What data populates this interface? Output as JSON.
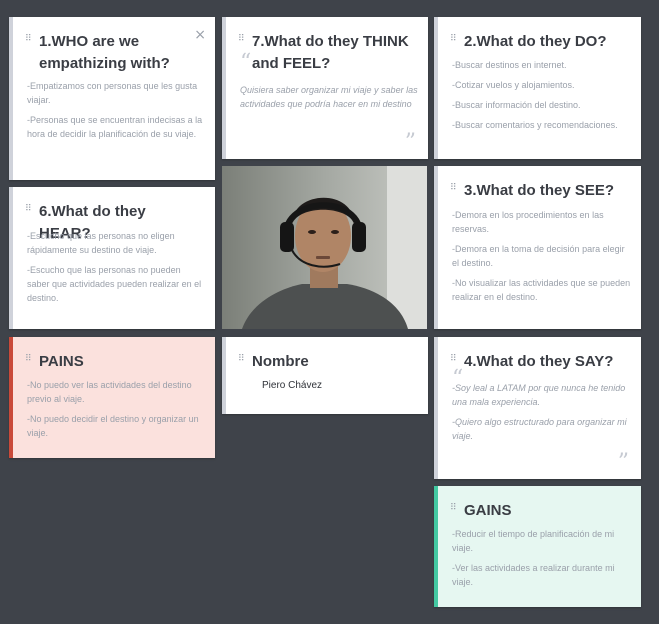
{
  "cards": {
    "who": {
      "title": "1.WHO are we empathizing with?",
      "close": "×",
      "items": [
        "-Empatizamos con personas que les gusta viajar.",
        "-Personas que se encuentran indecisas a la hora de decidir la planificación de su viaje."
      ]
    },
    "think": {
      "title": "7.What do they THINK and FEEL?",
      "items": [
        "Quisiera saber organizar mi viaje y saber las actividades que podría hacer en mi destino"
      ]
    },
    "do": {
      "title": "2.What do they DO?",
      "items": [
        "-Buscar destinos en internet.",
        "-Cotizar vuelos y alojamientos.",
        "-Buscar información del destino.",
        "-Buscar comentarios y recomendaciones."
      ]
    },
    "hear": {
      "title": "6.What do they HEAR?",
      "items": [
        "-Escucho que las personas no eligen rápidamente su destino de viaje.",
        "-Escucho que las personas no pueden saber que actividades pueden realizar en el destino."
      ]
    },
    "see": {
      "title": "3.What do they SEE?",
      "items": [
        "-Demora en los procedimientos en las reservas.",
        "-Demora en la toma de decisión para elegir el destino.",
        "-No visualizar las actividades que se pueden realizar en el destino."
      ]
    },
    "pains": {
      "title": "PAINS",
      "items": [
        "-No puedo ver las actividades del destino previo al viaje.",
        "-No puedo decidir el destino y organizar un viaje."
      ]
    },
    "name": {
      "title": "Nombre",
      "value": "Piero Chávez"
    },
    "say": {
      "title": "4.What do they SAY?",
      "items": [
        "-Soy leal a LATAM por que nunca he tenido una mala experiencia.",
        "-Quiero algo estructurado para organizar mi viaje."
      ]
    },
    "gains": {
      "title": "GAINS",
      "items": [
        "-Reducir el tiempo de planificación de mi viaje.",
        "-Ver las actividades a realizar durante mi viaje."
      ]
    }
  },
  "icons": {
    "grip": "drag-handle-icon",
    "quote_open": "“",
    "quote_close": "”"
  },
  "colors": {
    "board": "#3f434a",
    "pains_bg": "#fbe1dd",
    "pains_accent": "#c94a3a",
    "gains_bg": "#e6f7f1",
    "gains_accent": "#43c9a2"
  }
}
